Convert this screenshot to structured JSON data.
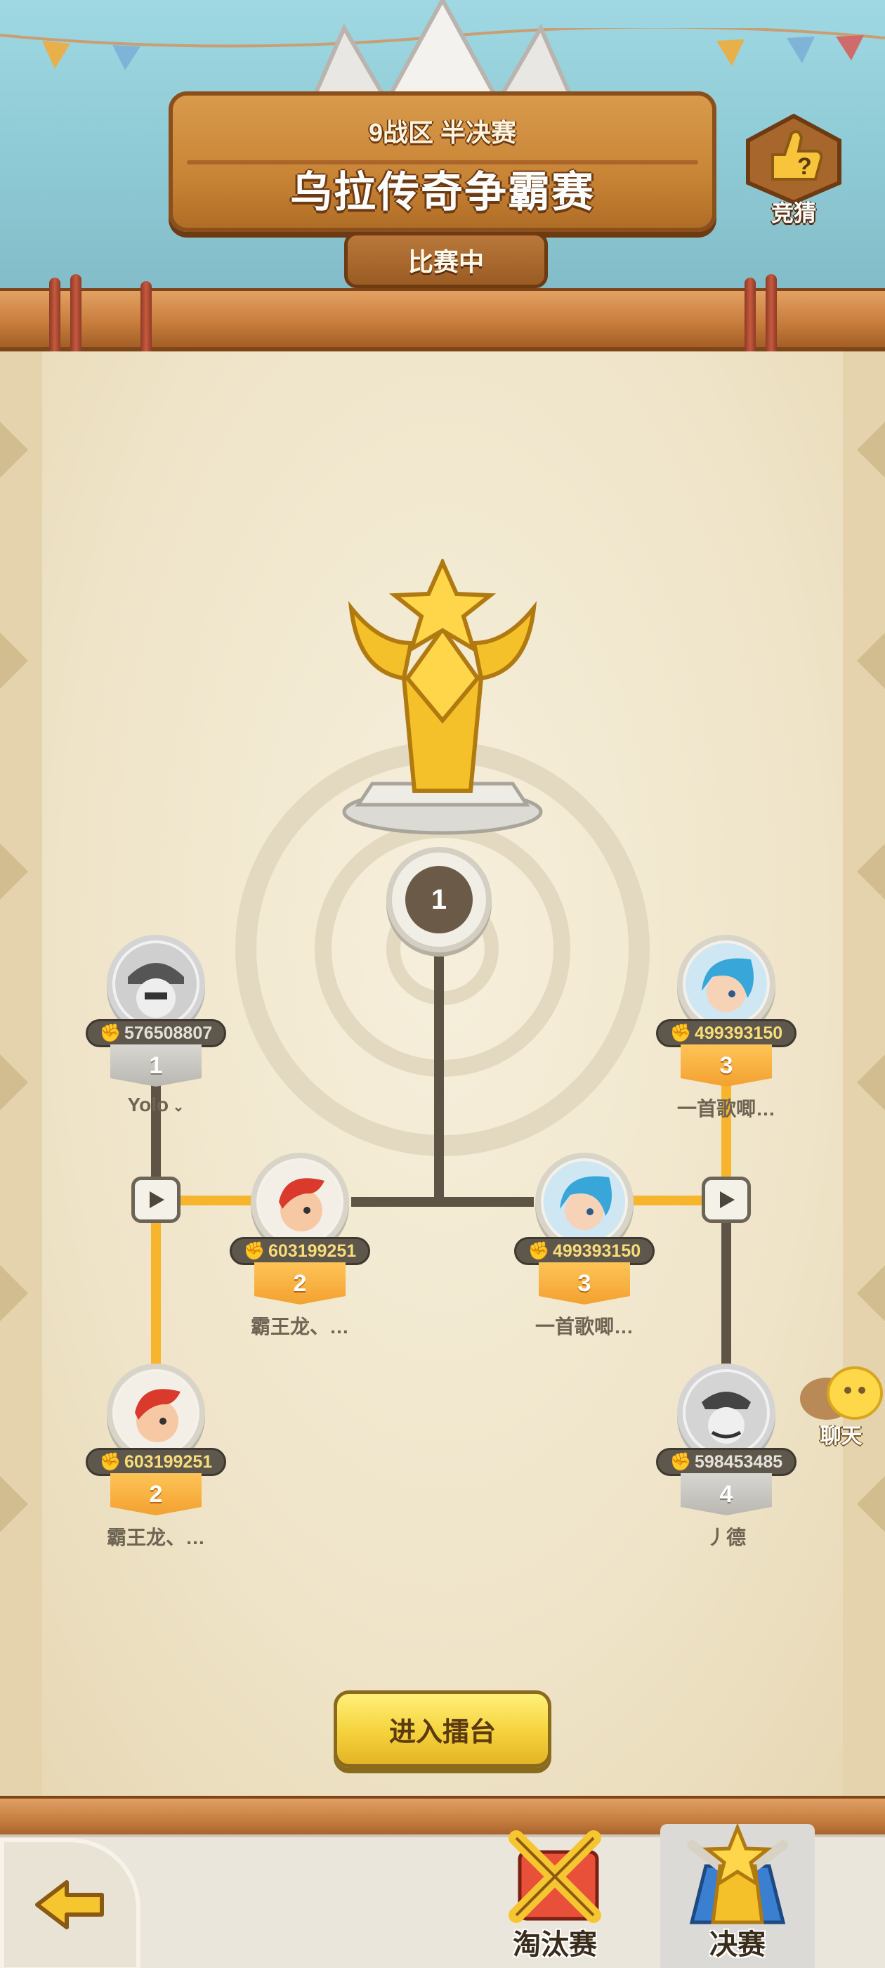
{
  "header": {
    "subtitle": "9战区 半决赛",
    "title": "乌拉传奇争霸赛",
    "status": "比赛中",
    "guess_label": "竞猜"
  },
  "bracket": {
    "final_rank": "1",
    "players": {
      "top_left": {
        "power": "576508807",
        "rank": "1",
        "name": "Yolo",
        "state": "eliminated"
      },
      "bottom_left": {
        "power": "603199251",
        "rank": "2",
        "name": "霸王龙、…",
        "state": "active"
      },
      "mid_left": {
        "power": "603199251",
        "rank": "2",
        "name": "霸王龙、…",
        "state": "active"
      },
      "mid_right": {
        "power": "499393150",
        "rank": "3",
        "name": "一首歌唧…",
        "state": "active"
      },
      "top_right": {
        "power": "499393150",
        "rank": "3",
        "name": "一首歌唧…",
        "state": "active"
      },
      "bottom_right": {
        "power": "598453485",
        "rank": "4",
        "name": "丿德",
        "state": "eliminated"
      }
    }
  },
  "actions": {
    "enter_arena": "进入擂台",
    "chat": "聊天"
  },
  "tabs": {
    "knockout": "淘汰赛",
    "final": "决赛"
  },
  "colors": {
    "winner_line": "#f6b52c",
    "loser_line": "#5e5446",
    "button_yellow": "#f5d23c"
  }
}
